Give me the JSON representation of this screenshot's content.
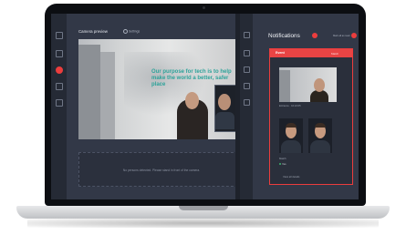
{
  "left_panel": {
    "title": "Camera preview",
    "settings_label": "Settings",
    "overlay_text": "Our purpose for tech is to help make the world a better, safer place",
    "empty_state": "No persons detected. Please stand in front of the camera."
  },
  "notifications": {
    "title": "Notifications",
    "mark_all": "Mark all as read",
    "card": {
      "label": "Event",
      "sub": "Match",
      "meta": "Entrance · 10:24:05",
      "match_label": "Match",
      "match_value": "Yes",
      "action": "View all details"
    }
  },
  "colors": {
    "accent": "#ec3d3d",
    "panel": "#323847",
    "sidebar": "#252a35",
    "overlay_text": "#2ea39a"
  }
}
